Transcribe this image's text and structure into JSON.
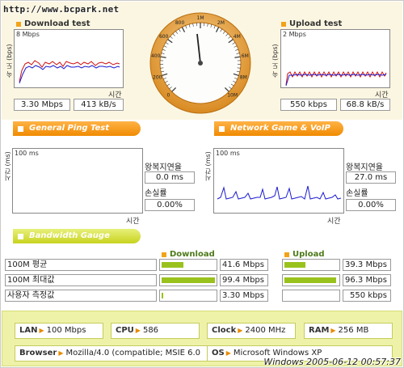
{
  "watermark": "http://www.bcpark.net",
  "download": {
    "title": "Download test",
    "graph_max": "8 Mbps",
    "y_axis": "속 도 (bps)",
    "x_axis": "시간",
    "speed_bps": "3.30 Mbps",
    "speed_Bps": "413 kB/s"
  },
  "upload": {
    "title": "Upload test",
    "graph_max": "2 Mbps",
    "y_axis": "속 도 (bps)",
    "x_axis": "시간",
    "speed_bps": "550 kbps",
    "speed_Bps": "68.8 kB/s"
  },
  "gauge": {
    "ticks": [
      "0",
      "200",
      "400",
      "600",
      "800",
      "1M",
      "2M",
      "4M",
      "6M",
      "8M",
      "10M"
    ]
  },
  "ping": {
    "tab_label": "General Ping Test",
    "graph_max": "100 ms",
    "y_axis": "시간 (ms)",
    "x_axis": "시간",
    "rtt_label": "왕복지연율",
    "rtt_value": "0.0 ms",
    "loss_label": "손실률",
    "loss_value": "0.00%"
  },
  "game": {
    "tab_label": "Network Game & VoIP Test",
    "graph_max": "100 ms",
    "y_axis": "시간 (ms)",
    "x_axis": "시간",
    "rtt_label": "왕복지연율",
    "rtt_value": "27.0 ms",
    "loss_label": "손실률",
    "loss_value": "0.00%"
  },
  "bandwidth": {
    "tab_label": "Bandwidth Gauge",
    "download_header": "Download",
    "upload_header": "Upload",
    "rows": [
      {
        "label": "100M 평균",
        "down": "41.6 Mbps",
        "down_frac": 0.416,
        "up": "39.3 Mbps",
        "up_frac": 0.393
      },
      {
        "label": "100M 최대값",
        "down": "99.4 Mbps",
        "down_frac": 0.994,
        "up": "96.3 Mbps",
        "up_frac": 0.963
      },
      {
        "label": "사용자 측정값",
        "down": "3.30 Mbps",
        "down_frac": 0.033,
        "up": "550 kbps",
        "up_frac": 0.0055
      }
    ]
  },
  "info": {
    "lan_key": "LAN",
    "lan_val": "100 Mbps",
    "cpu_key": "CPU",
    "cpu_val": "586",
    "clock_key": "Clock",
    "clock_val": "2400 MHz",
    "ram_key": "RAM",
    "ram_val": "256 MB",
    "browser_key": "Browser",
    "browser_val": "Mozilla/4.0 (compatible; MSIE 6.0",
    "os_key": "OS",
    "os_val": "Microsoft Windows XP",
    "timestamp": "Windows 2005-06-12 00:57:37"
  },
  "colors": {
    "accent_orange": "#f08a00",
    "gauge_ring": "#e9a23a",
    "bar_green": "#99c21c",
    "info_bg": "#eef2a8",
    "trace_red": "#d01010",
    "trace_blue": "#1a1ad0"
  }
}
